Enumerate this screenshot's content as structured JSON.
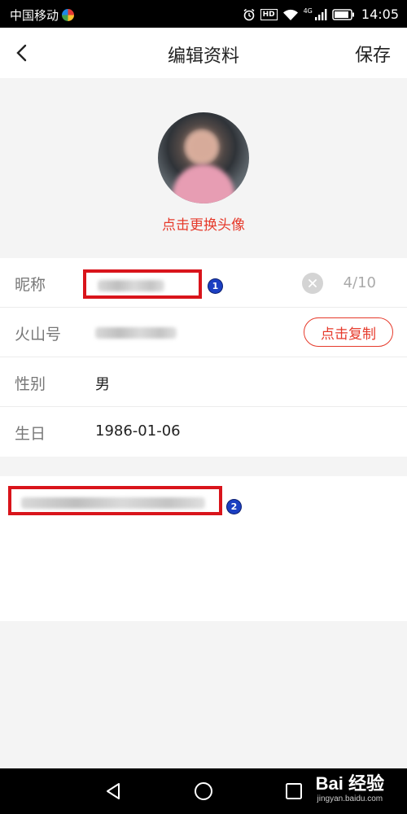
{
  "status_bar": {
    "carrier": "中国移动",
    "hd_label": "HD",
    "signal_label": "4G",
    "time": "14:05"
  },
  "header": {
    "title": "编辑资料",
    "save_label": "保存",
    "back_icon": "chevron-left-icon"
  },
  "avatar": {
    "change_label": "点击更换头像"
  },
  "form": {
    "nickname": {
      "label": "昵称",
      "char_count": "4/10",
      "callout": "1",
      "clear_icon": "close-icon"
    },
    "volcano_id": {
      "label": "火山号",
      "copy_label": "点击复制"
    },
    "gender": {
      "label": "性别",
      "value": "男"
    },
    "birthday": {
      "label": "生日",
      "value": "1986-01-06"
    }
  },
  "bio": {
    "callout": "2"
  },
  "nav_bar": {
    "back_icon": "triangle-back-icon",
    "home_icon": "circle-home-icon",
    "recent_icon": "square-recent-icon"
  },
  "watermark": {
    "main": "Bai 经验",
    "sub": "jingyan.baidu.com"
  },
  "colors": {
    "accent": "#e63a2b",
    "highlight_box": "#d9141b",
    "callout": "#1b3fc2"
  }
}
